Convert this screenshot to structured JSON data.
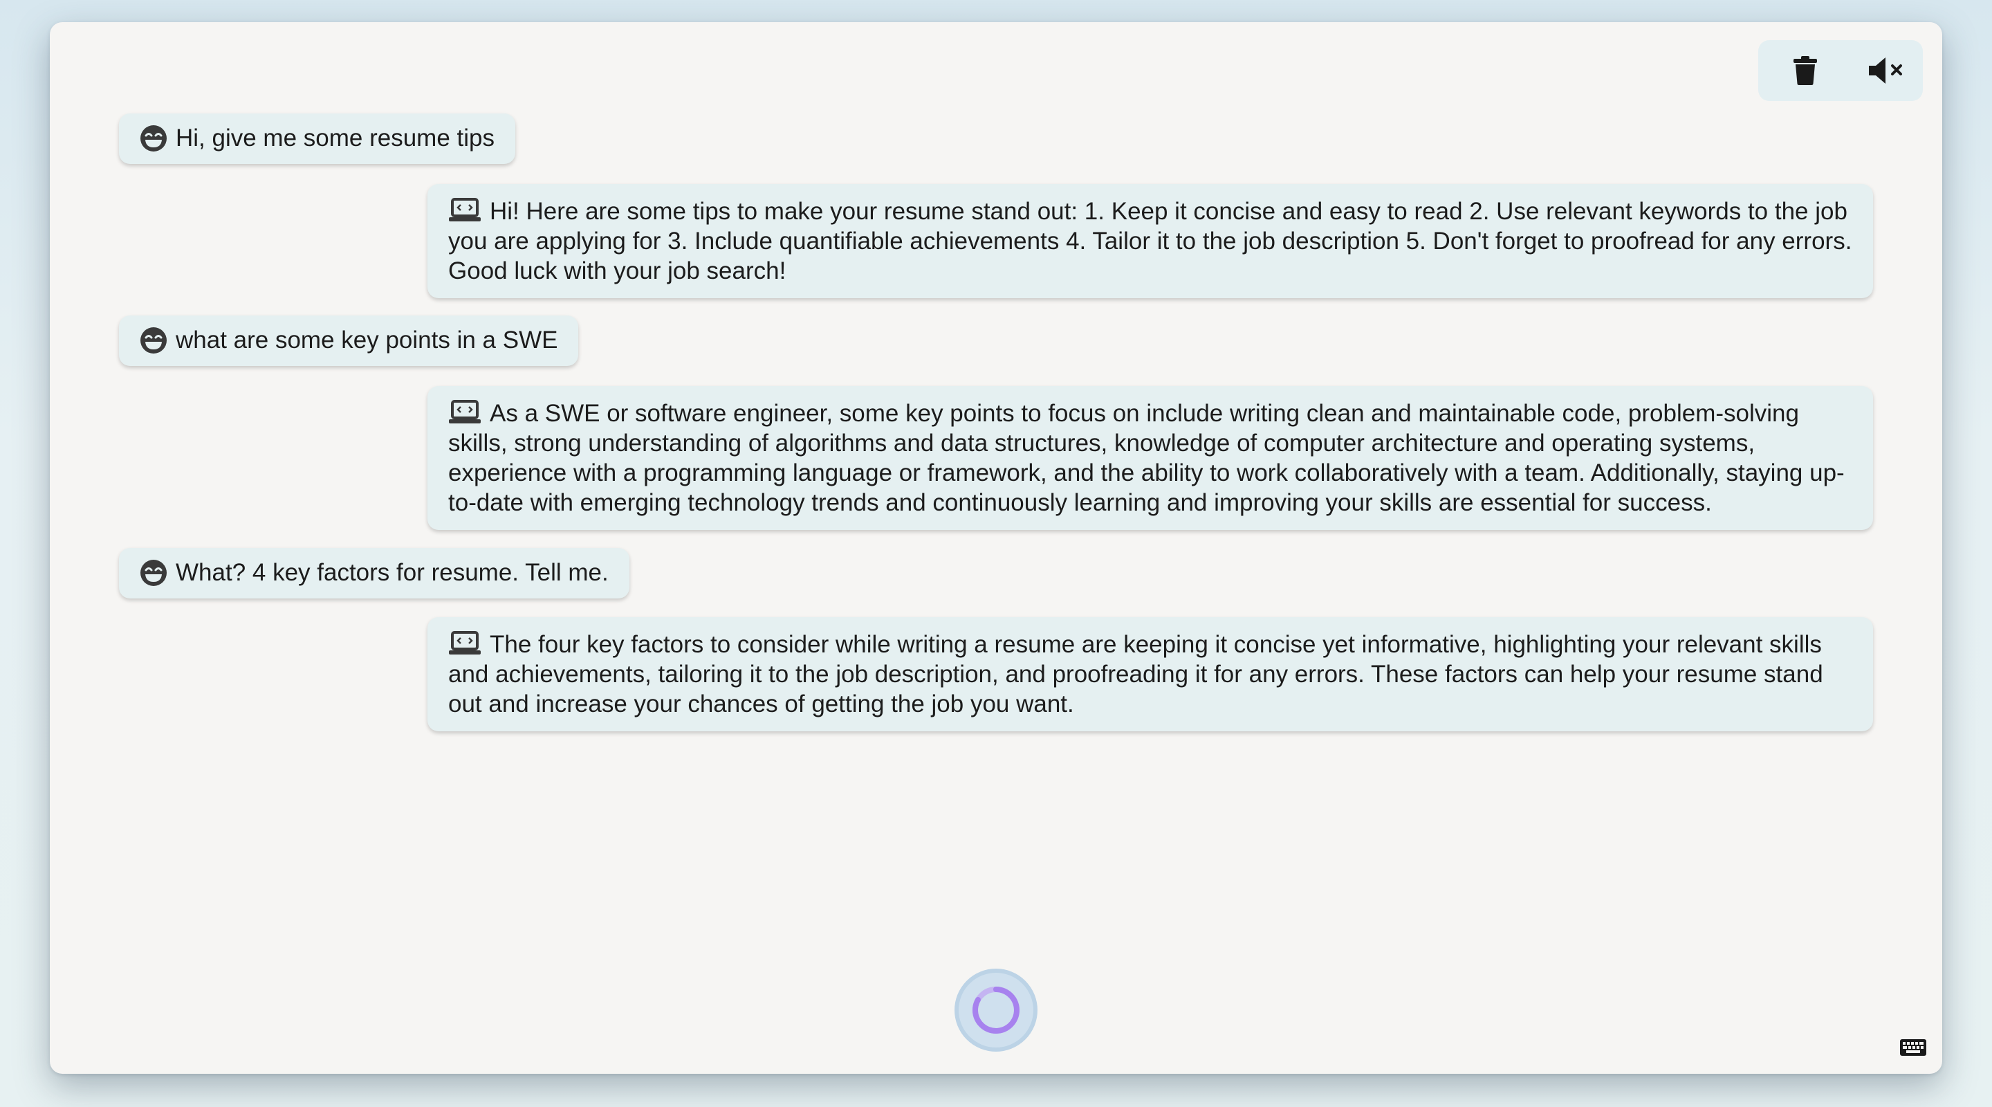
{
  "toolbar": {
    "icons": [
      "trash-icon",
      "speaker-muted-icon"
    ]
  },
  "messages": [
    {
      "role": "user",
      "avatar": "grinning-face-icon",
      "text": "Hi, give me some resume tips"
    },
    {
      "role": "assistant",
      "avatar": "laptop-code-icon",
      "text": "Hi! Here are some tips to make your resume stand out: 1. Keep it concise and easy to read 2. Use relevant keywords to the job you are applying for 3. Include quantifiable achievements 4. Tailor it to the job description 5. Don't forget to proofread for any errors. Good luck with your job search!"
    },
    {
      "role": "user",
      "avatar": "grinning-face-icon",
      "text": "what are some key points in a SWE"
    },
    {
      "role": "assistant",
      "avatar": "laptop-code-icon",
      "text": "As a SWE or software engineer, some key points to focus on include writing clean and maintainable code, problem-solving skills, strong understanding of algorithms and data structures, knowledge of computer architecture and operating systems, experience with a programming language or framework, and the ability to work collaboratively with a team. Additionally, staying up-to-date with emerging technology trends and continuously learning and improving your skills are essential for success."
    },
    {
      "role": "user",
      "avatar": "grinning-face-icon",
      "text": "What? 4 key factors for resume. Tell me."
    },
    {
      "role": "assistant",
      "avatar": "laptop-code-icon",
      "text": "The four key factors to consider while writing a resume are keeping it concise yet informative, highlighting your relevant skills and achievements, tailoring it to the job description, and proofreading it for any errors. These factors can help your resume stand out and increase your chances of getting the job you want."
    }
  ],
  "controls": {
    "mic_state": "listening",
    "keyboard_icon": "keyboard-icon"
  },
  "colors": {
    "bubble": "#e5f0f1",
    "window": "#f6f5f3",
    "accent": "#b48ef0"
  }
}
